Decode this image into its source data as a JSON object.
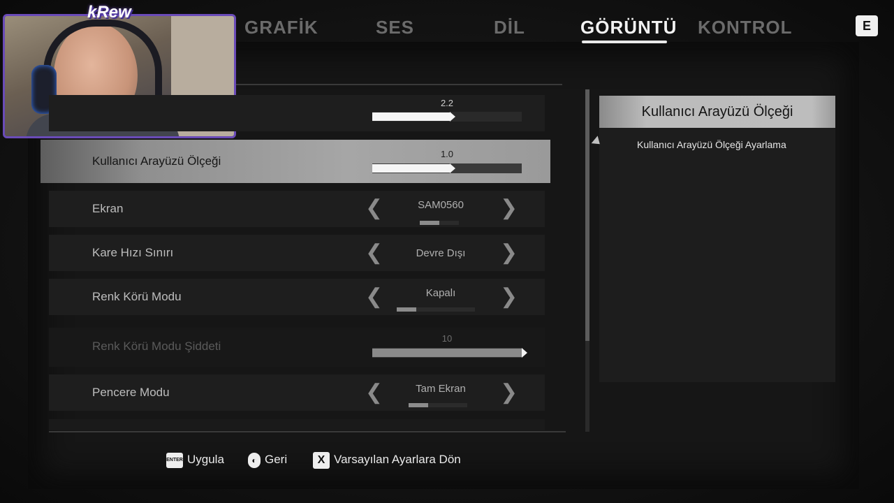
{
  "overlay": {
    "logo": "kRew"
  },
  "tabs": [
    {
      "label": "GRAFİK",
      "active": false
    },
    {
      "label": "SES",
      "active": false
    },
    {
      "label": "DİL",
      "active": false
    },
    {
      "label": "GÖRÜNTÜ",
      "active": true
    },
    {
      "label": "KONTROL",
      "active": false
    }
  ],
  "tab_key": "E",
  "settings": {
    "partial_slider": {
      "value": "2.2",
      "fraction": 0.52
    },
    "ui_scale": {
      "label": "Kullanıcı Arayüzü Ölçeği",
      "value": "1.0",
      "fraction": 0.52
    },
    "screen": {
      "label": "Ekran",
      "value": "SAM0560"
    },
    "frame_limit": {
      "label": "Kare Hızı Sınırı",
      "value": "Devre Dışı"
    },
    "colorblind": {
      "label": "Renk Körü Modu",
      "value": "Kapalı"
    },
    "colorblind_strength": {
      "label": "Renk Körü Modu Şiddeti",
      "value": "10",
      "fraction": 1.0
    },
    "window_mode": {
      "label": "Pencere Modu",
      "value": "Tam Ekran"
    }
  },
  "info": {
    "title": "Kullanıcı Arayüzü Ölçeği",
    "description": "Kullanıcı Arayüzü Ölçeği Ayarlama"
  },
  "bottom": {
    "apply_key": "ENTER",
    "apply": "Uygula",
    "back": "Geri",
    "reset_key": "X",
    "reset": "Varsayılan Ayarlara Dön"
  },
  "colors": {
    "accent": "#f2f2f2",
    "webcam_border": "#6a4bb8"
  }
}
